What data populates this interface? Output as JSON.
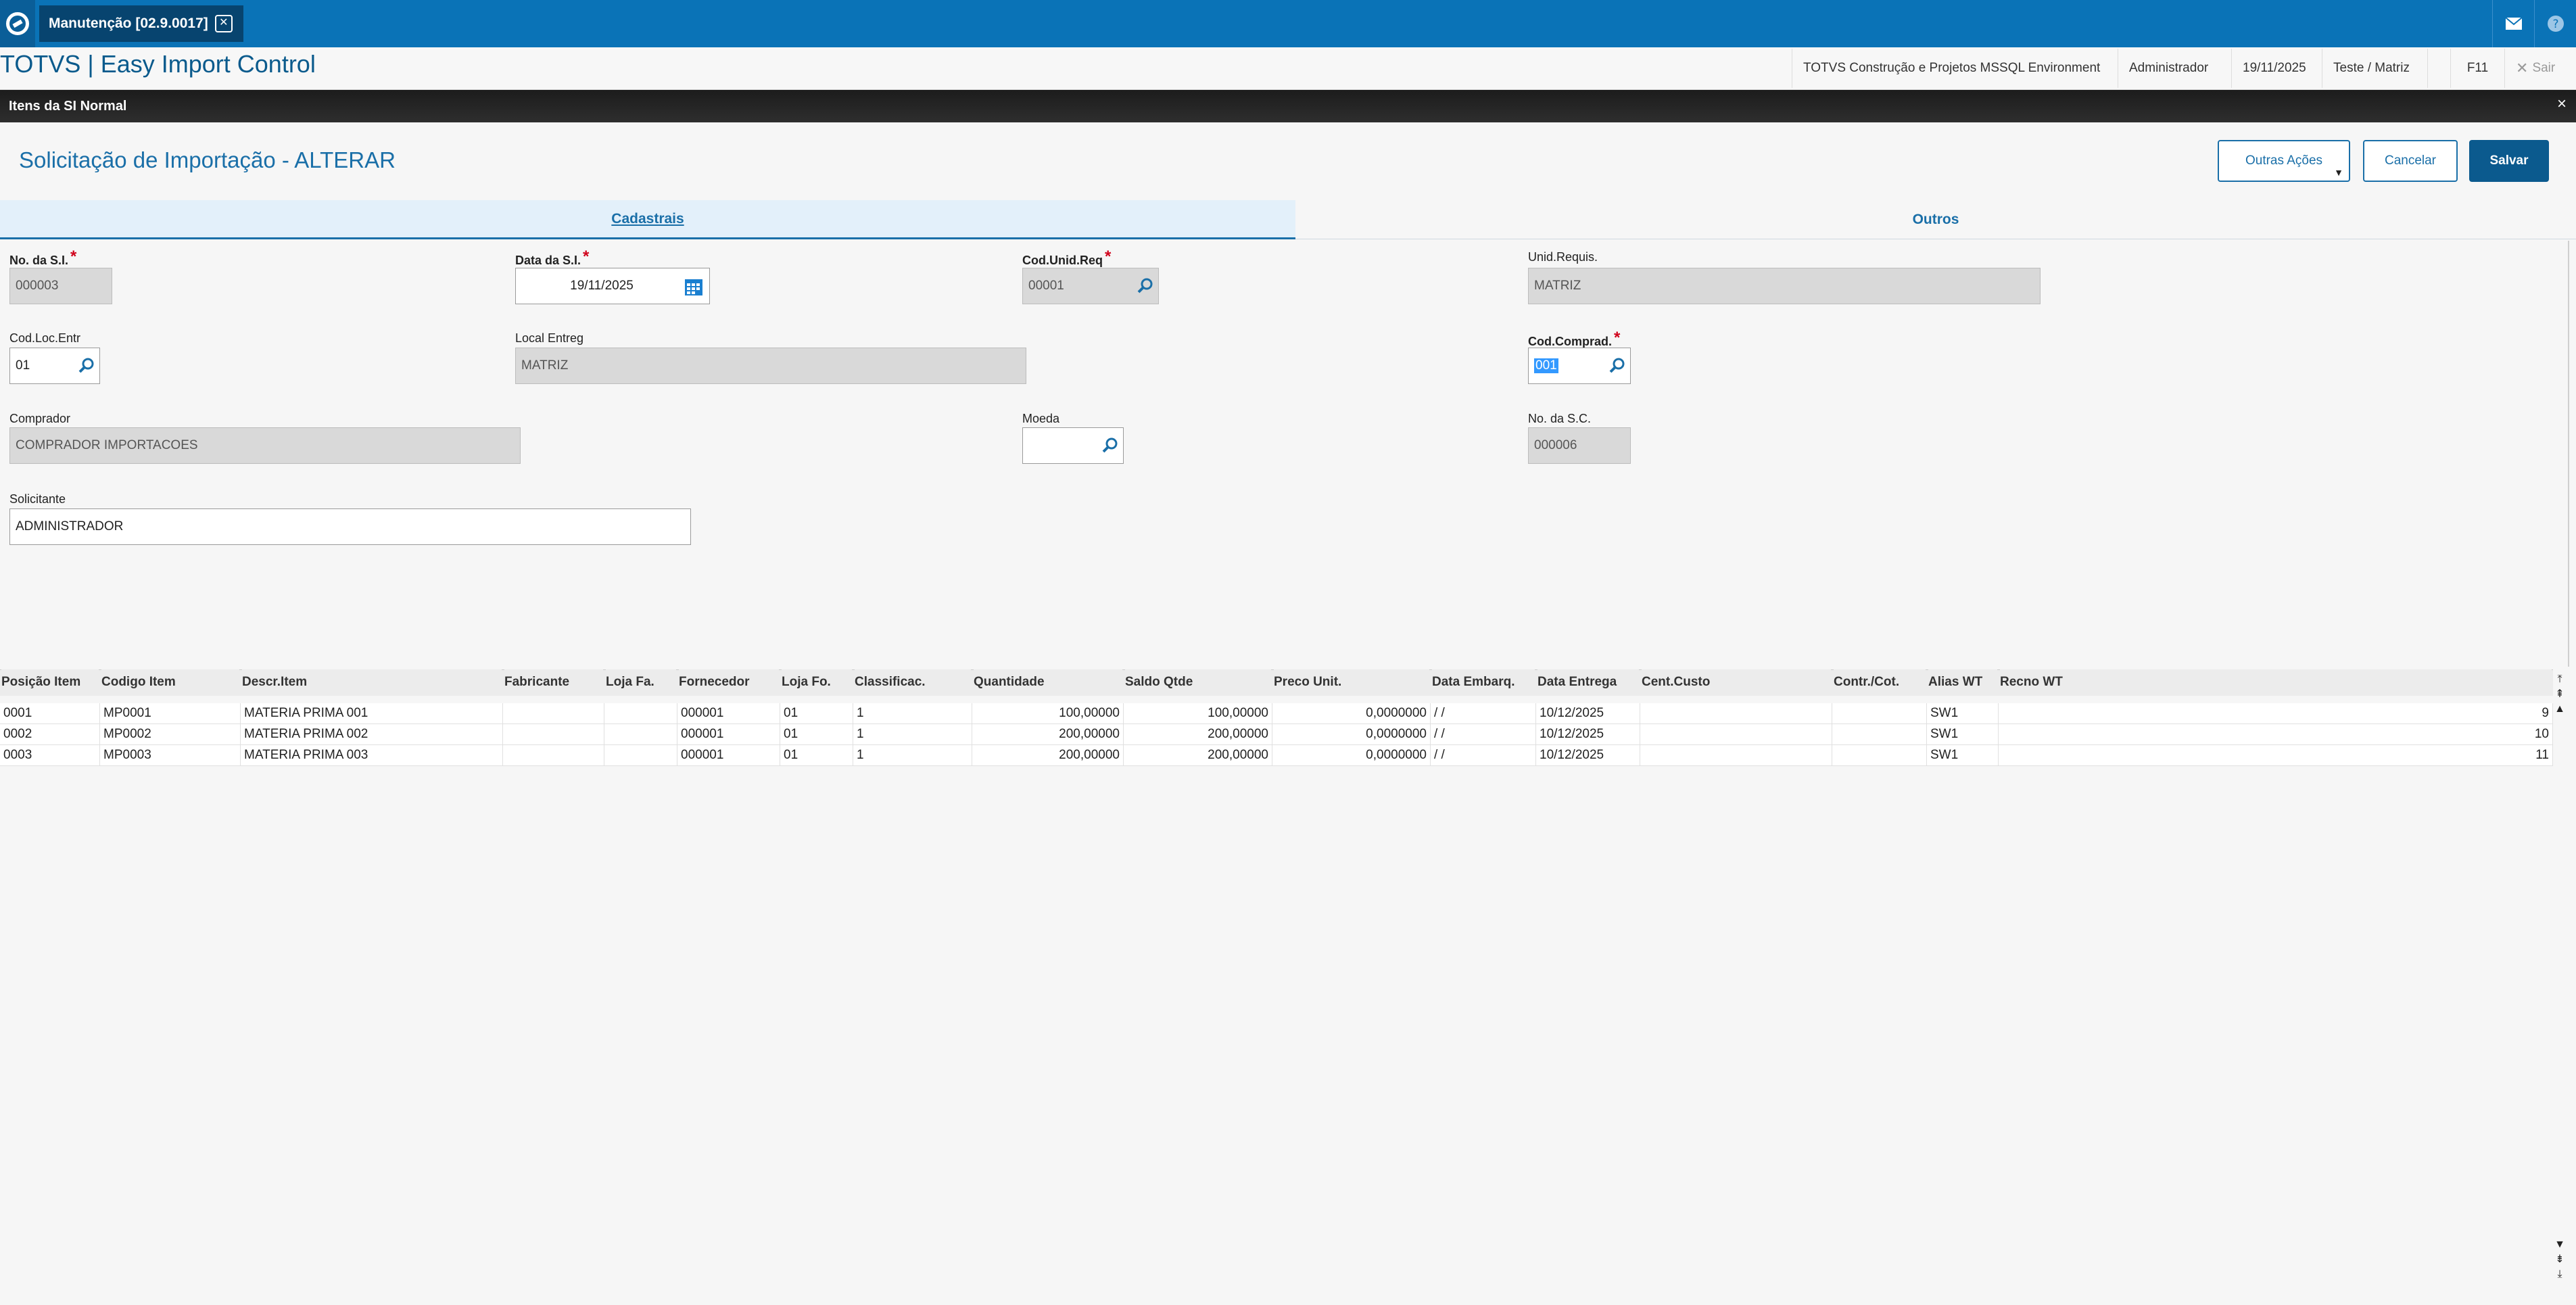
{
  "topbar": {
    "tab_label": "Manutenção [02.9.0017]",
    "close_glyph": "✕",
    "mail_icon": "mail-icon",
    "help_icon": "help-icon"
  },
  "header": {
    "app_title": "TOTVS | Easy Import Control",
    "environment": "TOTVS Construção e Projetos MSSQL Environment",
    "user": "Administrador",
    "date": "19/11/2025",
    "branch": "Teste / Matriz",
    "shortcut": "F11",
    "exit_label": "Sair"
  },
  "window": {
    "title": "Itens da SI Normal",
    "close_glyph": "×"
  },
  "page": {
    "title": "Solicitação de Importação - ALTERAR",
    "buttons": {
      "other_actions": "Outras Ações",
      "cancel": "Cancelar",
      "save": "Salvar"
    }
  },
  "tabs": {
    "cadastrais": "Cadastrais",
    "outros": "Outros"
  },
  "form": {
    "no_si": {
      "label": "No. da S.I.",
      "value": "000003",
      "required": true
    },
    "data_si": {
      "label": "Data da S.I.",
      "value": "19/11/2025",
      "required": true
    },
    "cod_unid_req": {
      "label": "Cod.Unid.Req",
      "value": "00001",
      "required": true
    },
    "unid_requis": {
      "label": "Unid.Requis.",
      "value": "MATRIZ"
    },
    "cod_loc_entr": {
      "label": "Cod.Loc.Entr",
      "value": "01"
    },
    "local_entreg": {
      "label": "Local Entreg",
      "value": "MATRIZ"
    },
    "cod_comprad": {
      "label": "Cod.Comprad.",
      "value": "001",
      "required": true
    },
    "comprador": {
      "label": "Comprador",
      "value": "COMPRADOR IMPORTACOES"
    },
    "moeda": {
      "label": "Moeda",
      "value": ""
    },
    "no_sc": {
      "label": "No. da S.C.",
      "value": "000006"
    },
    "solicitante": {
      "label": "Solicitante",
      "value": "ADMINISTRADOR"
    }
  },
  "grid": {
    "columns": [
      "Posição Item",
      "Codigo Item",
      "Descr.Item",
      "Fabricante",
      "Loja Fa.",
      "Fornecedor",
      "Loja Fo.",
      "Classificac.",
      "Quantidade",
      "Saldo Qtde",
      "Preco Unit.",
      "Data Embarq.",
      "Data Entrega",
      "Cent.Custo",
      "Contr./Cot.",
      "Alias WT",
      "Recno WT"
    ],
    "rows": [
      [
        "0001",
        "MP0001",
        "MATERIA PRIMA 001",
        "",
        "",
        "000001",
        "01",
        "1",
        "100,00000",
        "100,00000",
        "0,0000000",
        "/ /",
        "10/12/2025",
        "",
        "",
        "SW1",
        "9"
      ],
      [
        "0002",
        "MP0002",
        "MATERIA PRIMA 002",
        "",
        "",
        "000001",
        "01",
        "1",
        "200,00000",
        "200,00000",
        "0,0000000",
        "/ /",
        "10/12/2025",
        "",
        "",
        "SW1",
        "10"
      ],
      [
        "0003",
        "MP0003",
        "MATERIA PRIMA 003",
        "",
        "",
        "000001",
        "01",
        "1",
        "200,00000",
        "200,00000",
        "0,0000000",
        "/ /",
        "10/12/2025",
        "",
        "",
        "SW1",
        "11"
      ]
    ]
  },
  "colors": {
    "brand": "#0a73b7",
    "accent": "#1a6fa8",
    "required": "#d0021b"
  }
}
